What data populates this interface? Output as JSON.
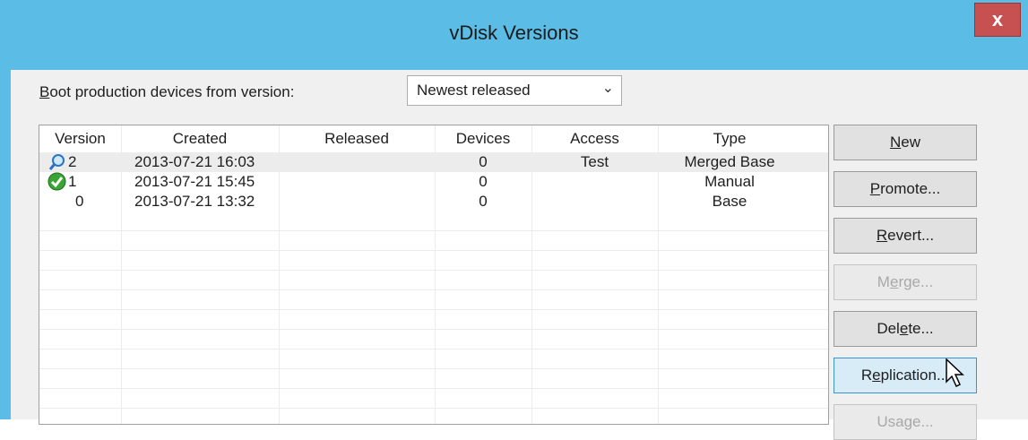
{
  "window": {
    "title": "vDisk Versions",
    "close_label": "x"
  },
  "boot": {
    "label_prefix": "B",
    "label_rest": "oot production devices from version:",
    "selected": "Newest released"
  },
  "table": {
    "headers": [
      "Version",
      "Created",
      "Released",
      "Devices",
      "Access",
      "Type"
    ],
    "rows": [
      {
        "icon": "magnifier-icon",
        "version": "2",
        "created": "2013-07-21 16:03",
        "released": "",
        "devices": "0",
        "access": "Test",
        "type": "Merged Base"
      },
      {
        "icon": "checkmark-icon",
        "version": "1",
        "created": "2013-07-21 15:45",
        "released": "",
        "devices": "0",
        "access": "",
        "type": "Manual"
      },
      {
        "icon": "",
        "version": "0",
        "created": "2013-07-21 13:32",
        "released": "",
        "devices": "0",
        "access": "",
        "type": "Base"
      }
    ]
  },
  "buttons": {
    "new": {
      "u": "N",
      "rest": "ew"
    },
    "promote": {
      "u": "P",
      "rest": "romote..."
    },
    "revert": {
      "u": "R",
      "rest": "evert..."
    },
    "merge": {
      "pre": "M",
      "u": "e",
      "rest": "rge..."
    },
    "delete": {
      "pre": "Del",
      "u": "e",
      "rest": "te..."
    },
    "replication": {
      "pre": "R",
      "u": "e",
      "rest": "plication..."
    },
    "usage": {
      "label": "Usage..."
    }
  },
  "colors": {
    "titlebar": "#5bbde6",
    "close": "#c75050",
    "selected_row": "#ececec",
    "hot_button": "#d8ecf8"
  }
}
